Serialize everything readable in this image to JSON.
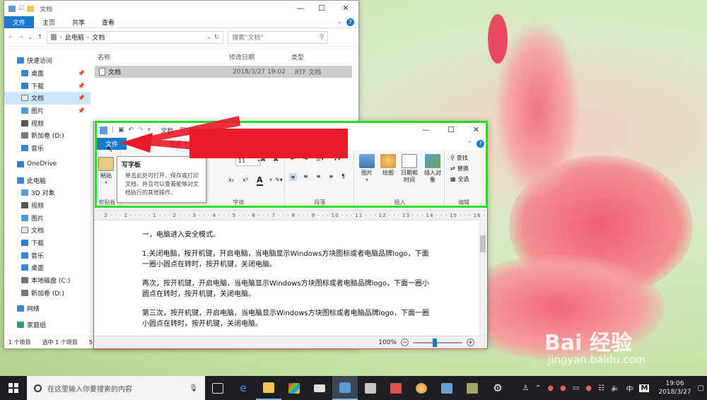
{
  "explorer": {
    "title": "文档",
    "tabs": [
      "文件",
      "主页",
      "共享",
      "查看"
    ],
    "path": [
      "此电脑",
      "文档"
    ],
    "search_placeholder": "搜索\"文档\"",
    "columns": [
      "名称",
      "修改日期",
      "类型"
    ],
    "file": {
      "name": "文档",
      "date": "2018/3/27 19:02",
      "type": "RTF 文档"
    },
    "sidebar": [
      {
        "label": "快速访问",
        "icon": "star-icon",
        "pin": false,
        "indent": 0
      },
      {
        "label": "桌面",
        "icon": "desktop-icon",
        "pin": true,
        "indent": 1
      },
      {
        "label": "下载",
        "icon": "download-icon",
        "pin": true,
        "indent": 1
      },
      {
        "label": "文档",
        "icon": "document-icon",
        "pin": true,
        "indent": 1,
        "selected": true
      },
      {
        "label": "图片",
        "icon": "picture-icon",
        "pin": true,
        "indent": 1
      },
      {
        "label": "视频",
        "icon": "video-icon",
        "pin": false,
        "indent": 1
      },
      {
        "label": "新加卷 (D:)",
        "icon": "drive-icon",
        "pin": false,
        "indent": 1
      },
      {
        "label": "音乐",
        "icon": "music-icon",
        "pin": false,
        "indent": 1
      },
      {
        "label": "OneDrive",
        "icon": "cloud-icon",
        "pin": false,
        "indent": 0,
        "gap": true
      },
      {
        "label": "此电脑",
        "icon": "computer-icon",
        "pin": false,
        "indent": 0,
        "gap": true
      },
      {
        "label": "3D 对象",
        "icon": "cube-icon",
        "pin": false,
        "indent": 1
      },
      {
        "label": "视频",
        "icon": "video-icon",
        "pin": false,
        "indent": 1
      },
      {
        "label": "图片",
        "icon": "picture-icon",
        "pin": false,
        "indent": 1
      },
      {
        "label": "文档",
        "icon": "document-icon",
        "pin": false,
        "indent": 1
      },
      {
        "label": "下载",
        "icon": "download-icon",
        "pin": false,
        "indent": 1
      },
      {
        "label": "音乐",
        "icon": "music-icon",
        "pin": false,
        "indent": 1
      },
      {
        "label": "桌面",
        "icon": "desktop-icon",
        "pin": false,
        "indent": 1
      },
      {
        "label": "本地磁盘 (C:)",
        "icon": "drive-icon",
        "pin": false,
        "indent": 1
      },
      {
        "label": "新加卷 (D:)",
        "icon": "drive-icon",
        "pin": false,
        "indent": 1
      },
      {
        "label": "网络",
        "icon": "network-icon",
        "pin": false,
        "indent": 0,
        "gap": true
      },
      {
        "label": "家庭组",
        "icon": "homegroup-icon",
        "pin": false,
        "indent": 0,
        "gap": true
      }
    ],
    "status": [
      "1 个项目",
      "选中 1 个项目",
      "5"
    ]
  },
  "wordpad": {
    "title": "文档 - 写字板",
    "tabs": [
      "文件",
      "主页",
      "查看"
    ],
    "groups": {
      "clipboard": "剪贴板",
      "font": "字体",
      "paragraph": "段落",
      "insert": "插入",
      "edit": "编辑"
    },
    "paste_label": "粘贴",
    "font_size": "11",
    "insert_buttons": [
      "图片",
      "绘图",
      "日期和时间",
      "插入对象"
    ],
    "edit_buttons": [
      "查找",
      "替换",
      "全选"
    ],
    "ruler": "· 2 · · · 1 · · · · · 1 · · · 2 · · · 3 · · · 4 · · · 5 · · · 6 · · · 7 · · · 8 · · · 9 · · · 10 · · · 11 · · · 12 · · · 13 · · · 14 · · · 15 · · · 16 ·",
    "paragraphs": [
      "一，电脑进入安全模式。",
      "1.关闭电脑，按开机键，开启电脑，当电脑显示Windows方块图标或者电脑品牌logo，下面一圈小圆点在转时，按开机键，关闭电脑。",
      "再次，按开机键，开启电脑，当电脑显示Windows方块图标或者电脑品牌logo，下面一圈小圆点在转时，按开机键，关闭电脑。",
      "第三次，按开机键，开启电脑，当电脑显示Windows方块图标或者电脑品牌logo，下面一圈小圆点在转时，按开机键，关闭电脑。"
    ],
    "zoom": "100%"
  },
  "tooltip": {
    "title": "写字板",
    "desc": "单击此处可打开、保存或打印文档，并且可以查看能够对文档执行的其他操作。"
  },
  "taskbar": {
    "search_placeholder": "在这里输入你要搜索的内容",
    "ime": "中",
    "ime2": "M",
    "time": "19:06",
    "date": "2018/3/27"
  },
  "watermark": {
    "brand": "Bai 经验",
    "url": "jingyan.baidu.com"
  },
  "colors": {
    "accent": "#1979ca",
    "highlight_green": "#22dd22",
    "arrow_red": "#ea1a28"
  }
}
